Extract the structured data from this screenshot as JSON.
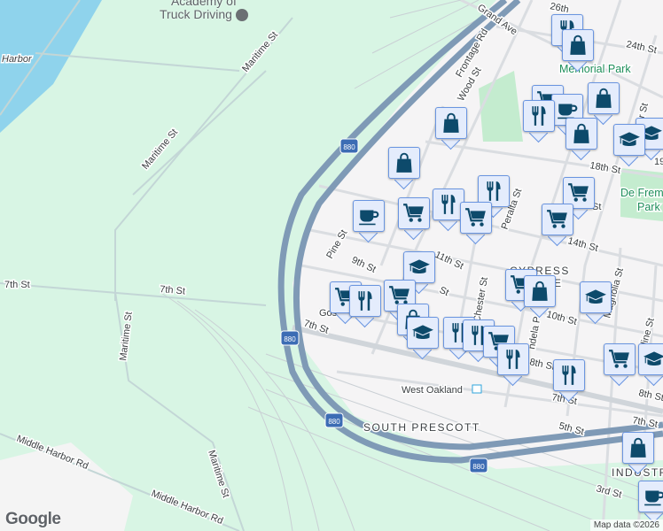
{
  "map": {
    "places": {
      "academy": "Academy of\nTruck Driving",
      "harbor": "Harbor",
      "west_oakland": "West Oakland"
    },
    "parks": {
      "memorial": "Memorial Park",
      "de_fremery_1": "De Frem",
      "de_fremery_2": "Park"
    },
    "neighborhoods": {
      "cypress_1": "CYPRESS",
      "cypress_2": "E",
      "south_prescott": "SOUTH PRESCOTT",
      "industrial": "INDUSTRI"
    },
    "streets": {
      "maritime_1": "Maritime St",
      "maritime_2": "Maritime St",
      "maritime_3": "Maritime St",
      "maritime_4": "Maritime St",
      "seventh_1": "7th St",
      "seventh_2": "7th St",
      "seventh_3": "7th St",
      "seventh_4": "7th St",
      "seventh_5": "7th St",
      "middle_harbor_1": "Middle Harbor Rd",
      "middle_harbor_2": "Middle Harbor Rd",
      "grand": "Grand Ave",
      "frontage": "Frontage Rd",
      "wood": "Wood St",
      "pine": "Pine St",
      "ninth": "9th St",
      "eleventh": "11th St",
      "peralta": "Peralta St",
      "chester": "Chester St",
      "mandela": "ndela P",
      "tenth": "10th St",
      "magnolia": "Magnolia St",
      "adeline": "line St",
      "eighth": "8th St",
      "eighth_2": "8th St",
      "fifth": "5th St",
      "third": "3rd St",
      "fourteenth": "14th St",
      "eighteenth": "18th St",
      "twentyfourth": "24th St",
      "twentysixth": "26th",
      "gos": "Gos",
      "st": "St",
      "st2": "St",
      "ar": "ar St",
      "st19": "19"
    },
    "highway_shield": "880",
    "attribution": "Map data ©2026",
    "logo": "Google"
  },
  "colors": {
    "water": "#8fd3ec",
    "green": "#d6f5e3",
    "park": "#c4eccf",
    "highway": "#8aa3bd",
    "marker_bg": "#e4ecfc",
    "marker_icon": "#0d4a6b"
  }
}
